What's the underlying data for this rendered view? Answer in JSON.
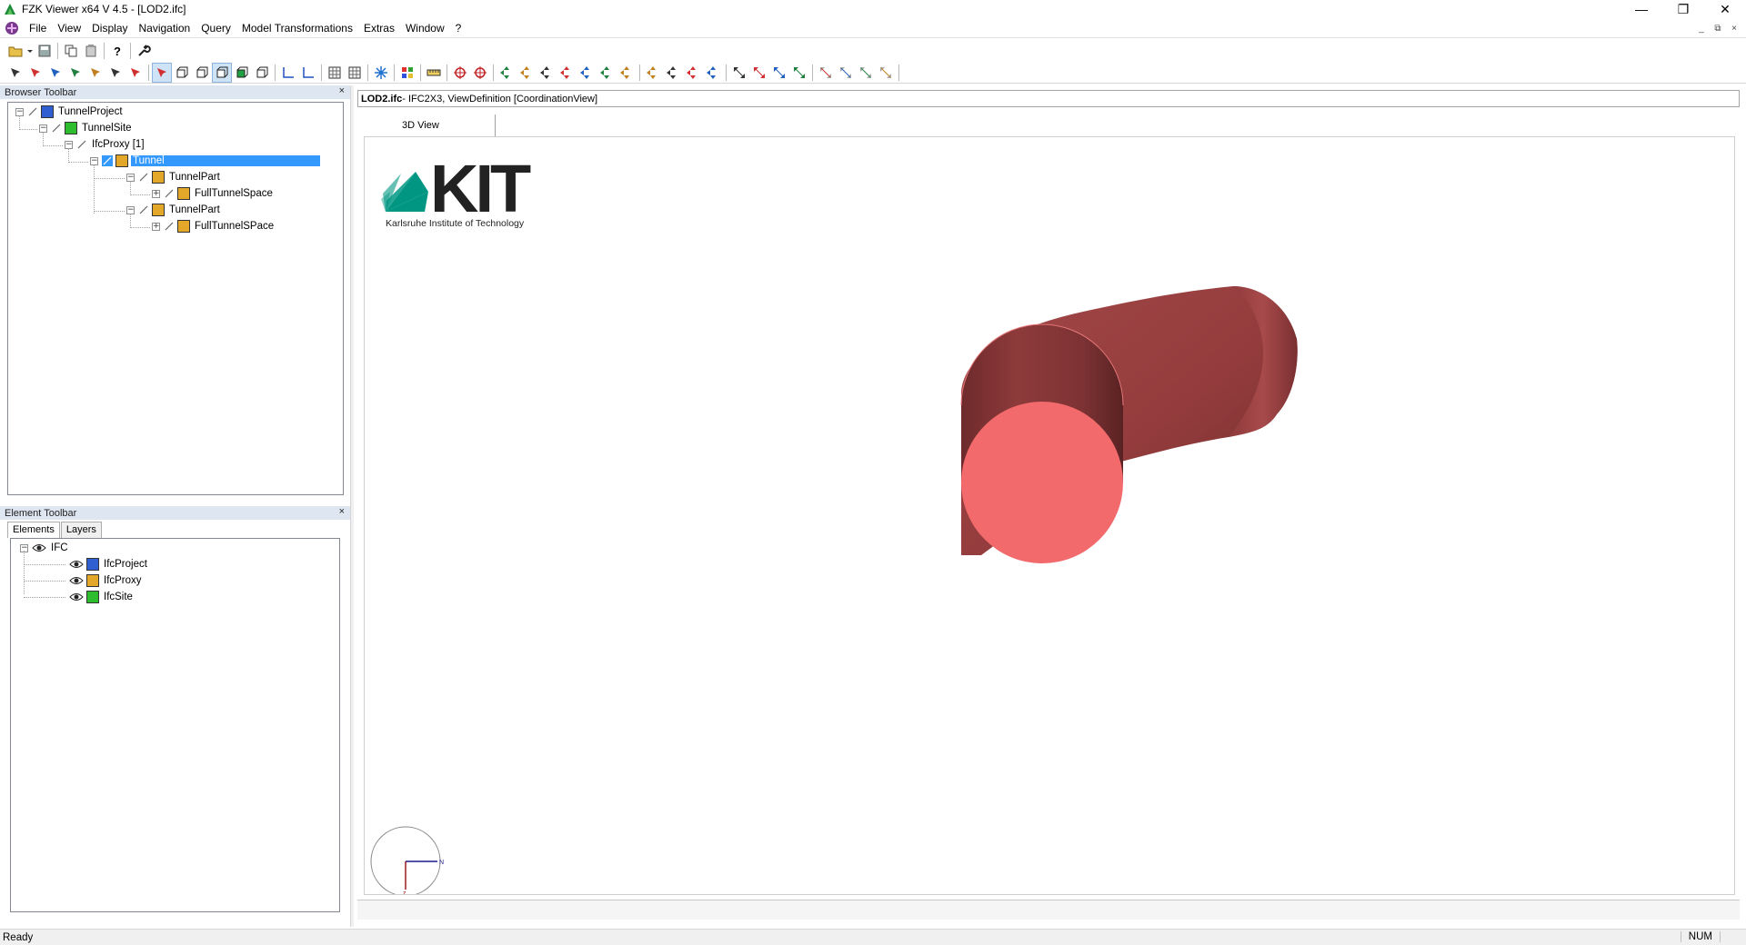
{
  "window": {
    "title": "FZK Viewer x64 V 4.5 - [LOD2.ifc]",
    "controls": [
      "—",
      "❐",
      "✕"
    ]
  },
  "menu": {
    "items": [
      "File",
      "View",
      "Display",
      "Navigation",
      "Query",
      "Model Transformations",
      "Extras",
      "Window",
      "?"
    ],
    "mdi_controls": [
      "_",
      "⧉",
      "×"
    ]
  },
  "browser": {
    "title": "Browser Toolbar",
    "close": "×",
    "tree": [
      {
        "label": "TunnelProject",
        "type": "project"
      },
      {
        "label": "TunnelSite",
        "type": "site"
      },
      {
        "label": "IfcProxy [1]",
        "type": "group"
      },
      {
        "label": "Tunnel",
        "type": "proxy",
        "selected": true
      },
      {
        "label": "TunnelPart",
        "type": "proxy"
      },
      {
        "label": "FullTunnelSpace",
        "type": "proxy"
      },
      {
        "label": "TunnelPart",
        "type": "proxy"
      },
      {
        "label": "FullTunnelSPace",
        "type": "proxy"
      }
    ]
  },
  "elements": {
    "title": "Element Toolbar",
    "close": "×",
    "tabs": [
      "Elements",
      "Layers"
    ],
    "tree": [
      {
        "label": "IFC"
      },
      {
        "label": "IfcProject",
        "type": "project"
      },
      {
        "label": "IfcProxy",
        "type": "proxy"
      },
      {
        "label": "IfcSite",
        "type": "site"
      }
    ]
  },
  "document": {
    "file": "LOD2.ifc",
    "info": " - IFC2X3, ViewDefinition [CoordinationView]",
    "view_tab": "3D View"
  },
  "logo": {
    "text": "KIT",
    "subtitle": "Karlsruhe Institute of Technology"
  },
  "axis": {
    "n_label": "N",
    "z_label": "z"
  },
  "colors": {
    "tunnel_body": "#9c3f40",
    "tunnel_face": "#f26a6b",
    "selection": "#3399ff",
    "logo_green": "#009682"
  },
  "status": {
    "text": "Ready",
    "num": "NUM"
  }
}
